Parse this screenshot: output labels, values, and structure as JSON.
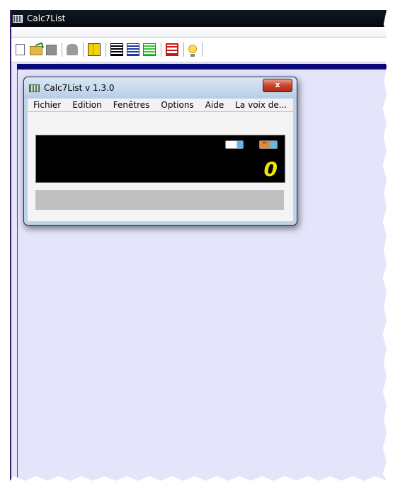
{
  "main_window": {
    "title": "Calc7List",
    "toolbar": {
      "buttons": [
        {
          "name": "new-file-icon"
        },
        {
          "name": "open-folder-icon"
        },
        {
          "name": "save-icon"
        },
        {
          "name": "print-icon"
        },
        {
          "name": "calculator-icon"
        },
        {
          "name": "grid-black-icon"
        },
        {
          "name": "grid-blue-icon"
        },
        {
          "name": "grid-green-icon"
        },
        {
          "name": "abacus-icon"
        },
        {
          "name": "lightbulb-icon"
        }
      ]
    }
  },
  "calc_window": {
    "title": "Calc7List v 1.3.0",
    "close_label": "x",
    "menu": [
      "Fichier",
      "Edition",
      "Fenêtres",
      "Options",
      "Aide",
      "La voix de..."
    ],
    "display_value": "0",
    "colors": {
      "display_bg": "#000000",
      "display_text": "#f2e600"
    }
  }
}
